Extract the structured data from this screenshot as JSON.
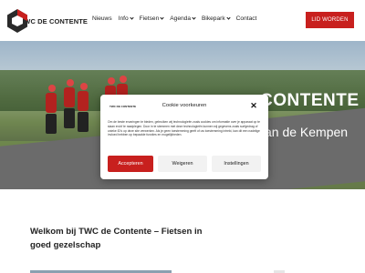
{
  "header": {
    "logo_text": "TWC DE CONTENTE",
    "nav": [
      {
        "label": "Nieuws",
        "dropdown": false
      },
      {
        "label": "Info",
        "dropdown": true
      },
      {
        "label": "Fietsen",
        "dropdown": true
      },
      {
        "label": "Agenda",
        "dropdown": true
      },
      {
        "label": "Bikepark",
        "dropdown": true
      },
      {
        "label": "Contact",
        "dropdown": false
      }
    ],
    "cta_label": "LID WORDEN"
  },
  "hero": {
    "title": "CONTENTE",
    "subtitle": "van de Kempen"
  },
  "cookie_modal": {
    "logo_text": "TWC DE CONTENTE",
    "title": "Cookie voorkeuren",
    "close_symbol": "✕",
    "text": "Om de beste ervaringen te bieden, gebruiken wij technologieën zoals cookies om informatie over je apparaat op te slaan en/of te raadplegen. Door in te stemmen met deze technologieën kunnen wij gegevens zoals surfgedrag of unieke ID's op deze site verwerken. Als je geen toestemming geeft of uw toestemming intrekt, kan dit een nadelige invloed hebben op bepaalde functies en mogelijkheden.",
    "accept_label": "Accepteren",
    "decline_label": "Weigeren",
    "settings_label": "Instellingen"
  },
  "main": {
    "welcome_heading": "Welkom bij TWC de Contente – Fietsen in goed gezelschap"
  },
  "colors": {
    "accent": "#c8201e",
    "text": "#222222"
  }
}
